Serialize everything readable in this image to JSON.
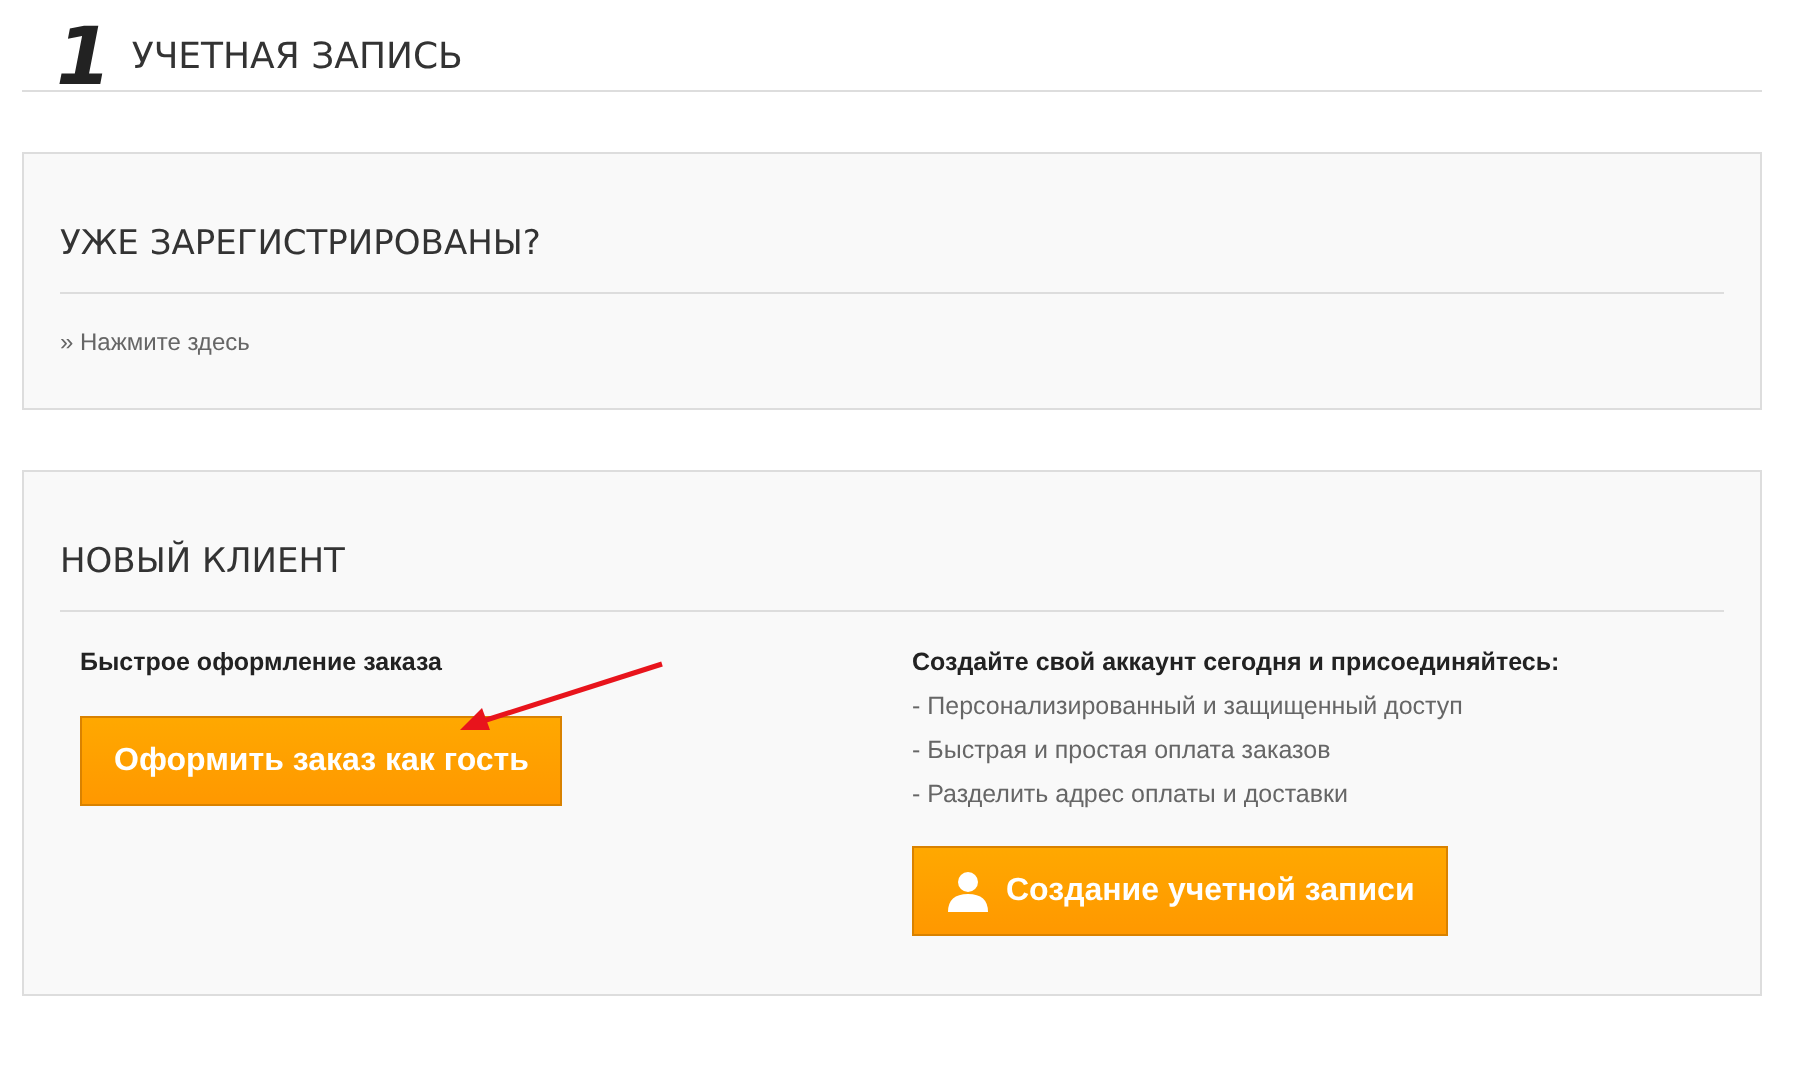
{
  "step": {
    "number": "1",
    "title": "УЧЕТНАЯ ЗАПИСЬ"
  },
  "registered": {
    "title": "УЖЕ ЗАРЕГИСТРИРОВАНЫ?",
    "link": "» Нажмите здесь"
  },
  "new_customer": {
    "title": "НОВЫЙ КЛИЕНТ",
    "guest": {
      "heading": "Быстрое оформление заказа",
      "button": "Оформить заказ как гость"
    },
    "account": {
      "heading": "Создайте свой аккаунт сегодня и присоединяйтесь:",
      "benefits": [
        "- Персонализированный и защищенный доступ",
        "- Быстрая и простая оплата заказов",
        "- Разделить адрес оплаты и доставки"
      ],
      "button": "Создание учетной записи"
    }
  }
}
